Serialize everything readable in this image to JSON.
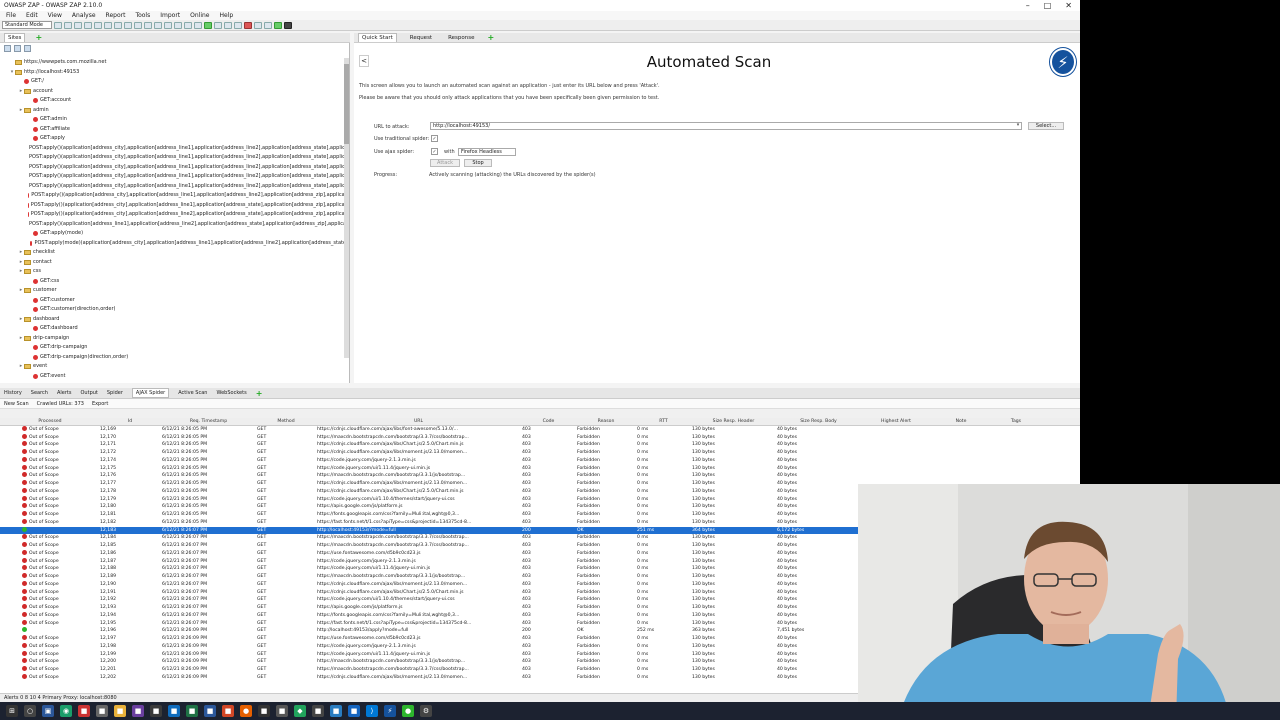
{
  "window": {
    "title": "OWASP ZAP - OWASP ZAP 2.10.0"
  },
  "menu": [
    "File",
    "Edit",
    "View",
    "Analyse",
    "Report",
    "Tools",
    "Import",
    "Online",
    "Help"
  ],
  "toolbar": {
    "mode": "Standard Mode"
  },
  "sites": {
    "tab": "Sites",
    "nodes": [
      {
        "d": 1,
        "e": "",
        "t": "https://wwwpets.com.mozilla.net",
        "i": "folder"
      },
      {
        "d": 1,
        "e": "▾",
        "t": "http://localhost:49153",
        "i": "folder"
      },
      {
        "d": 2,
        "e": "",
        "t": "GET:/",
        "i": "leaf"
      },
      {
        "d": 2,
        "e": "▸",
        "t": "account",
        "i": "folder"
      },
      {
        "d": 3,
        "e": "",
        "t": "GET:account",
        "i": "leaf"
      },
      {
        "d": 2,
        "e": "▸",
        "t": "admin",
        "i": "folder"
      },
      {
        "d": 3,
        "e": "",
        "t": "GET:admin",
        "i": "leaf"
      },
      {
        "d": 3,
        "e": "",
        "t": "GET:affiliate",
        "i": "leaf"
      },
      {
        "d": 3,
        "e": "",
        "t": "GET:apply",
        "i": "leaf"
      },
      {
        "d": 3,
        "e": "",
        "t": "POST:apply()(application[address_city],application[address_line1],application[address_line2],application[address_state],applicati",
        "i": "leaf"
      },
      {
        "d": 3,
        "e": "",
        "t": "POST:apply()(application[address_city],application[address_line1],application[address_line2],application[address_state],applicati",
        "i": "leaf"
      },
      {
        "d": 3,
        "e": "",
        "t": "POST:apply()(application[address_city],application[address_line1],application[address_line2],application[address_state],applicati",
        "i": "leaf"
      },
      {
        "d": 3,
        "e": "",
        "t": "POST:apply()(application[address_city],application[address_line1],application[address_line2],application[address_state],applicati",
        "i": "leaf"
      },
      {
        "d": 3,
        "e": "",
        "t": "POST:apply()(application[address_city],application[address_line1],application[address_line2],application[address_state],applicati",
        "i": "leaf"
      },
      {
        "d": 3,
        "e": "",
        "t": "POST:apply()(application[address_city],application[address_line1],application[address_line2],application[address_zip],applicati",
        "i": "leaf"
      },
      {
        "d": 3,
        "e": "",
        "t": "POST:apply()(application[address_city],application[address_line1],application[address_state],application[address_zip],applicati",
        "i": "leaf"
      },
      {
        "d": 3,
        "e": "",
        "t": "POST:apply()(application[address_city],application[address_line2],application[address_state],application[address_zip],applicati",
        "i": "leaf"
      },
      {
        "d": 3,
        "e": "",
        "t": "POST:apply()(application[address_line1],application[address_line2],application[address_state],application[address_zip],applicati",
        "i": "leaf"
      },
      {
        "d": 3,
        "e": "",
        "t": "GET:apply(mode)",
        "i": "leaf"
      },
      {
        "d": 3,
        "e": "",
        "t": "POST:apply(mode)(application[address_city],application[address_line1],application[address_line2],application[address_state]",
        "i": "leaf"
      },
      {
        "d": 2,
        "e": "▸",
        "t": "checklist",
        "i": "folder"
      },
      {
        "d": 2,
        "e": "▸",
        "t": "contact",
        "i": "folder"
      },
      {
        "d": 2,
        "e": "▸",
        "t": "css",
        "i": "folder"
      },
      {
        "d": 3,
        "e": "",
        "t": "GET:css",
        "i": "leaf"
      },
      {
        "d": 2,
        "e": "▸",
        "t": "customer",
        "i": "folder"
      },
      {
        "d": 3,
        "e": "",
        "t": "GET:customer",
        "i": "leaf"
      },
      {
        "d": 3,
        "e": "",
        "t": "GET:customer(direction,order)",
        "i": "leaf"
      },
      {
        "d": 2,
        "e": "▸",
        "t": "dashboard",
        "i": "folder"
      },
      {
        "d": 3,
        "e": "",
        "t": "GET:dashboard",
        "i": "leaf"
      },
      {
        "d": 2,
        "e": "▸",
        "t": "drip-campaign",
        "i": "folder"
      },
      {
        "d": 3,
        "e": "",
        "t": "GET:drip-campaign",
        "i": "leaf"
      },
      {
        "d": 3,
        "e": "",
        "t": "GET:drip-campaign(direction,order)",
        "i": "leaf"
      },
      {
        "d": 2,
        "e": "▸",
        "t": "event",
        "i": "folder"
      },
      {
        "d": 3,
        "e": "",
        "t": "GET:event",
        "i": "leaf"
      }
    ]
  },
  "workspace": {
    "tabs": [
      "Quick Start",
      "Request",
      "Response"
    ],
    "title": "Automated Scan",
    "desc1": "This screen allows you to launch an automated scan against an application - just enter its URL below and press 'Attack'.",
    "desc2": "Please be aware that you should only attack applications that you have been specifically been given permission to test.",
    "url_label": "URL to attack:",
    "url_value": "http://localhost:49153/",
    "select_label": "Select...",
    "trad_label": "Use traditional spider:",
    "ajax_label": "Use ajax spider:",
    "with_label": "with",
    "browser": "Firefox Headless",
    "attack_label": "Attack",
    "stop_label": "Stop",
    "progress_label": "Progress:",
    "progress_text": "Actively scanning (attacking) the URLs discovered by the spider(s)"
  },
  "bottom": {
    "tabs": [
      "History",
      "Search",
      "Alerts",
      "Output",
      "Spider",
      "AJAX Spider",
      "Active Scan",
      "WebSockets"
    ],
    "new_scan": "New Scan",
    "crawled": "Crawled URLs: 373",
    "export": "Export",
    "columns": [
      "Processed",
      "Id",
      "Req. Timestamp",
      "Method",
      "URL",
      "Code",
      "Reason",
      "RTT",
      "Size Resp. Header",
      "Size Resp. Body",
      "Highest Alert",
      "Note",
      "Tags"
    ],
    "rows": [
      {
        "s": "r",
        "p": "Out of Scope",
        "id": "12,169",
        "ts": "6/12/21 8:26:05 PM",
        "m": "GET",
        "u": "https://cdnjs.cloudflare.com/ajax/libs/font-awesome/5.13.0/...",
        "c": "403",
        "r": "Forbidden",
        "rtt": "0 ms",
        "h": "130 bytes",
        "b": "40 bytes"
      },
      {
        "s": "r",
        "p": "Out of Scope",
        "id": "12,170",
        "ts": "6/12/21 8:26:05 PM",
        "m": "GET",
        "u": "https://maxcdn.bootstrapcdn.com/bootstrap/3.3.7/css/bootstrap...",
        "c": "403",
        "r": "Forbidden",
        "rtt": "0 ms",
        "h": "130 bytes",
        "b": "40 bytes"
      },
      {
        "s": "r",
        "p": "Out of Scope",
        "id": "12,171",
        "ts": "6/12/21 8:26:05 PM",
        "m": "GET",
        "u": "https://cdnjs.cloudflare.com/ajax/libs/Chart.js/2.5.0/Chart.min.js",
        "c": "403",
        "r": "Forbidden",
        "rtt": "0 ms",
        "h": "130 bytes",
        "b": "40 bytes"
      },
      {
        "s": "r",
        "p": "Out of Scope",
        "id": "12,172",
        "ts": "6/12/21 8:26:05 PM",
        "m": "GET",
        "u": "https://cdnjs.cloudflare.com/ajax/libs/moment.js/2.13.0/momen...",
        "c": "403",
        "r": "Forbidden",
        "rtt": "0 ms",
        "h": "130 bytes",
        "b": "40 bytes"
      },
      {
        "s": "r",
        "p": "Out of Scope",
        "id": "12,174",
        "ts": "6/12/21 8:26:05 PM",
        "m": "GET",
        "u": "https://code.jquery.com/jquery-2.1.3.min.js",
        "c": "403",
        "r": "Forbidden",
        "rtt": "0 ms",
        "h": "130 bytes",
        "b": "40 bytes"
      },
      {
        "s": "r",
        "p": "Out of Scope",
        "id": "12,175",
        "ts": "6/12/21 8:26:05 PM",
        "m": "GET",
        "u": "https://code.jquery.com/ui/1.11.4/jquery-ui.min.js",
        "c": "403",
        "r": "Forbidden",
        "rtt": "0 ms",
        "h": "130 bytes",
        "b": "40 bytes"
      },
      {
        "s": "r",
        "p": "Out of Scope",
        "id": "12,176",
        "ts": "6/12/21 8:26:05 PM",
        "m": "GET",
        "u": "https://maxcdn.bootstrapcdn.com/bootstrap/3.3.1/js/bootstrap...",
        "c": "403",
        "r": "Forbidden",
        "rtt": "0 ms",
        "h": "130 bytes",
        "b": "40 bytes"
      },
      {
        "s": "r",
        "p": "Out of Scope",
        "id": "12,177",
        "ts": "6/12/21 8:26:05 PM",
        "m": "GET",
        "u": "https://cdnjs.cloudflare.com/ajax/libs/moment.js/2.13.0/momen...",
        "c": "403",
        "r": "Forbidden",
        "rtt": "0 ms",
        "h": "130 bytes",
        "b": "40 bytes"
      },
      {
        "s": "r",
        "p": "Out of Scope",
        "id": "12,178",
        "ts": "6/12/21 8:26:05 PM",
        "m": "GET",
        "u": "https://cdnjs.cloudflare.com/ajax/libs/Chart.js/2.5.0/Chart.min.js",
        "c": "403",
        "r": "Forbidden",
        "rtt": "0 ms",
        "h": "130 bytes",
        "b": "40 bytes"
      },
      {
        "s": "r",
        "p": "Out of Scope",
        "id": "12,179",
        "ts": "6/12/21 8:26:05 PM",
        "m": "GET",
        "u": "https://code.jquery.com/ui/1.10.4/themes/start/jquery-ui.css",
        "c": "403",
        "r": "Forbidden",
        "rtt": "0 ms",
        "h": "130 bytes",
        "b": "40 bytes"
      },
      {
        "s": "r",
        "p": "Out of Scope",
        "id": "12,180",
        "ts": "6/12/21 8:26:05 PM",
        "m": "GET",
        "u": "https://apis.google.com/js/platform.js",
        "c": "403",
        "r": "Forbidden",
        "rtt": "0 ms",
        "h": "130 bytes",
        "b": "40 bytes"
      },
      {
        "s": "r",
        "p": "Out of Scope",
        "id": "12,181",
        "ts": "6/12/21 8:26:05 PM",
        "m": "GET",
        "u": "https://fonts.googleapis.com/css?family=Muli:ital,wght@0,3...",
        "c": "403",
        "r": "Forbidden",
        "rtt": "0 ms",
        "h": "130 bytes",
        "b": "40 bytes"
      },
      {
        "s": "r",
        "p": "Out of Scope",
        "id": "12,182",
        "ts": "6/12/21 8:26:05 PM",
        "m": "GET",
        "u": "https://fast.fonts.net/t/1.css?apiType=css&projectid=134375cd-8...",
        "c": "403",
        "r": "Forbidden",
        "rtt": "0 ms",
        "h": "130 bytes",
        "b": "40 bytes"
      },
      {
        "s": "g",
        "p": "",
        "id": "12,183",
        "ts": "6/12/21 8:26:07 PM",
        "m": "GET",
        "u": "http://localhost:49153/?mode=full",
        "c": "200",
        "r": "OK",
        "rtt": "251 ms",
        "h": "364 bytes",
        "b": "6,172 bytes",
        "sel": true
      },
      {
        "s": "r",
        "p": "Out of Scope",
        "id": "12,184",
        "ts": "6/12/21 8:26:07 PM",
        "m": "GET",
        "u": "https://maxcdn.bootstrapcdn.com/bootstrap/3.3.7/css/bootstrap...",
        "c": "403",
        "r": "Forbidden",
        "rtt": "0 ms",
        "h": "130 bytes",
        "b": "40 bytes"
      },
      {
        "s": "r",
        "p": "Out of Scope",
        "id": "12,185",
        "ts": "6/12/21 8:26:07 PM",
        "m": "GET",
        "u": "https://maxcdn.bootstrapcdn.com/bootstrap/3.3.7/css/bootstrap...",
        "c": "403",
        "r": "Forbidden",
        "rtt": "0 ms",
        "h": "130 bytes",
        "b": "40 bytes"
      },
      {
        "s": "r",
        "p": "Out of Scope",
        "id": "12,186",
        "ts": "6/12/21 8:26:07 PM",
        "m": "GET",
        "u": "https://use.fontawesome.com/d5b9c0cd23.js",
        "c": "403",
        "r": "Forbidden",
        "rtt": "0 ms",
        "h": "130 bytes",
        "b": "40 bytes"
      },
      {
        "s": "r",
        "p": "Out of Scope",
        "id": "12,187",
        "ts": "6/12/21 8:26:07 PM",
        "m": "GET",
        "u": "https://code.jquery.com/jquery-2.1.3.min.js",
        "c": "403",
        "r": "Forbidden",
        "rtt": "0 ms",
        "h": "130 bytes",
        "b": "40 bytes"
      },
      {
        "s": "r",
        "p": "Out of Scope",
        "id": "12,188",
        "ts": "6/12/21 8:26:07 PM",
        "m": "GET",
        "u": "https://code.jquery.com/ui/1.11.4/jquery-ui.min.js",
        "c": "403",
        "r": "Forbidden",
        "rtt": "0 ms",
        "h": "130 bytes",
        "b": "40 bytes"
      },
      {
        "s": "r",
        "p": "Out of Scope",
        "id": "12,189",
        "ts": "6/12/21 8:26:07 PM",
        "m": "GET",
        "u": "https://maxcdn.bootstrapcdn.com/bootstrap/3.3.1/js/bootstrap...",
        "c": "403",
        "r": "Forbidden",
        "rtt": "0 ms",
        "h": "130 bytes",
        "b": "40 bytes"
      },
      {
        "s": "r",
        "p": "Out of Scope",
        "id": "12,190",
        "ts": "6/12/21 8:26:07 PM",
        "m": "GET",
        "u": "https://cdnjs.cloudflare.com/ajax/libs/moment.js/2.13.0/momen...",
        "c": "403",
        "r": "Forbidden",
        "rtt": "0 ms",
        "h": "130 bytes",
        "b": "40 bytes"
      },
      {
        "s": "r",
        "p": "Out of Scope",
        "id": "12,191",
        "ts": "6/12/21 8:26:07 PM",
        "m": "GET",
        "u": "https://cdnjs.cloudflare.com/ajax/libs/Chart.js/2.5.0/Chart.min.js",
        "c": "403",
        "r": "Forbidden",
        "rtt": "0 ms",
        "h": "130 bytes",
        "b": "40 bytes"
      },
      {
        "s": "r",
        "p": "Out of Scope",
        "id": "12,192",
        "ts": "6/12/21 8:26:07 PM",
        "m": "GET",
        "u": "https://code.jquery.com/ui/1.10.4/themes/start/jquery-ui.css",
        "c": "403",
        "r": "Forbidden",
        "rtt": "0 ms",
        "h": "130 bytes",
        "b": "40 bytes"
      },
      {
        "s": "r",
        "p": "Out of Scope",
        "id": "12,193",
        "ts": "6/12/21 8:26:07 PM",
        "m": "GET",
        "u": "https://apis.google.com/js/platform.js",
        "c": "403",
        "r": "Forbidden",
        "rtt": "0 ms",
        "h": "130 bytes",
        "b": "40 bytes"
      },
      {
        "s": "r",
        "p": "Out of Scope",
        "id": "12,194",
        "ts": "6/12/21 8:26:07 PM",
        "m": "GET",
        "u": "https://fonts.googleapis.com/css?family=Muli:ital,wght@0,3...",
        "c": "403",
        "r": "Forbidden",
        "rtt": "0 ms",
        "h": "130 bytes",
        "b": "40 bytes"
      },
      {
        "s": "r",
        "p": "Out of Scope",
        "id": "12,195",
        "ts": "6/12/21 8:26:07 PM",
        "m": "GET",
        "u": "https://fast.fonts.net/t/1.css?apiType=css&projectid=134375cd-8...",
        "c": "403",
        "r": "Forbidden",
        "rtt": "0 ms",
        "h": "130 bytes",
        "b": "40 bytes"
      },
      {
        "s": "g",
        "p": "",
        "id": "12,196",
        "ts": "6/12/21 8:26:09 PM",
        "m": "GET",
        "u": "http://localhost:49153/apply?mode=full",
        "c": "200",
        "r": "OK",
        "rtt": "252 ms",
        "h": "363 bytes",
        "b": "7,451 bytes"
      },
      {
        "s": "r",
        "p": "Out of Scope",
        "id": "12,197",
        "ts": "6/12/21 8:26:09 PM",
        "m": "GET",
        "u": "https://use.fontawesome.com/d5b9c0cd23.js",
        "c": "403",
        "r": "Forbidden",
        "rtt": "0 ms",
        "h": "130 bytes",
        "b": "40 bytes"
      },
      {
        "s": "r",
        "p": "Out of Scope",
        "id": "12,198",
        "ts": "6/12/21 8:26:09 PM",
        "m": "GET",
        "u": "https://code.jquery.com/jquery-2.1.3.min.js",
        "c": "403",
        "r": "Forbidden",
        "rtt": "0 ms",
        "h": "130 bytes",
        "b": "40 bytes"
      },
      {
        "s": "r",
        "p": "Out of Scope",
        "id": "12,199",
        "ts": "6/12/21 8:26:09 PM",
        "m": "GET",
        "u": "https://code.jquery.com/ui/1.11.4/jquery-ui.min.js",
        "c": "403",
        "r": "Forbidden",
        "rtt": "0 ms",
        "h": "130 bytes",
        "b": "40 bytes"
      },
      {
        "s": "r",
        "p": "Out of Scope",
        "id": "12,200",
        "ts": "6/12/21 8:26:09 PM",
        "m": "GET",
        "u": "https://maxcdn.bootstrapcdn.com/bootstrap/3.3.1/js/bootstrap...",
        "c": "403",
        "r": "Forbidden",
        "rtt": "0 ms",
        "h": "130 bytes",
        "b": "40 bytes"
      },
      {
        "s": "r",
        "p": "Out of Scope",
        "id": "12,201",
        "ts": "6/12/21 8:26:09 PM",
        "m": "GET",
        "u": "https://maxcdn.bootstrapcdn.com/bootstrap/3.3.7/css/bootstrap...",
        "c": "403",
        "r": "Forbidden",
        "rtt": "0 ms",
        "h": "130 bytes",
        "b": "40 bytes"
      },
      {
        "s": "r",
        "p": "Out of Scope",
        "id": "12,202",
        "ts": "6/12/21 8:26:09 PM",
        "m": "GET",
        "u": "https://cdnjs.cloudflare.com/ajax/libs/moment.js/2.13.0/momen...",
        "c": "403",
        "r": "Forbidden",
        "rtt": "0 ms",
        "h": "130 bytes",
        "b": "40 bytes"
      }
    ]
  },
  "status": {
    "text": "Alerts  0  8  10  4   Primary Proxy: localhost:8080"
  },
  "colors": {
    "selected_row": "#1f6fd1",
    "out_of_scope": "#d02a2a",
    "ok": "#2db52d",
    "logo": "#15529d"
  }
}
